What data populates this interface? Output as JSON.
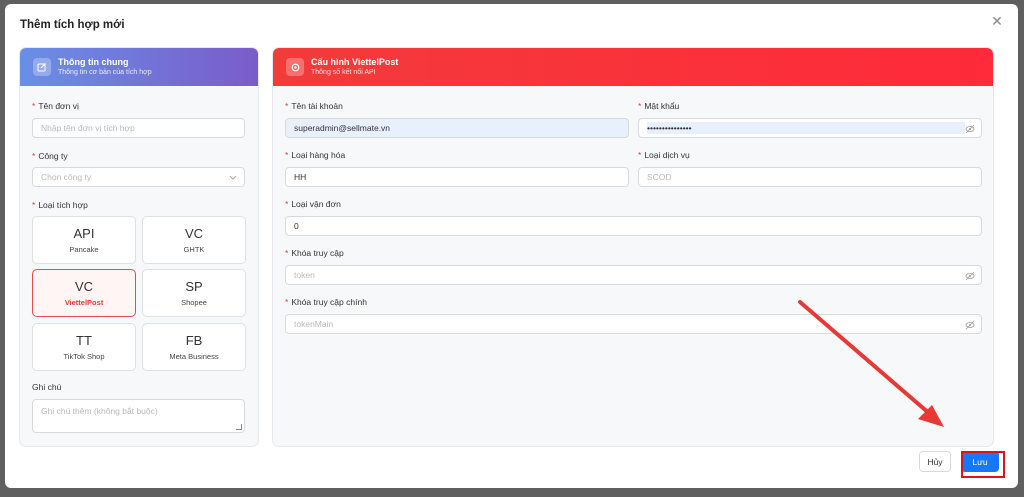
{
  "modal": {
    "title": "Thêm tích hợp mới"
  },
  "left": {
    "title": "Thông tin chung",
    "subtitle": "Thông tin cơ bản của tích hợp",
    "unit_label": "Tên đơn vị",
    "unit_placeholder": "Nhập tên đơn vị tích hợp",
    "company_label": "Công ty",
    "company_placeholder": "Chọn công ty",
    "type_label": "Loại tích hợp",
    "cards": [
      {
        "code": "API",
        "name": "Pancake"
      },
      {
        "code": "VC",
        "name": "GHTK"
      },
      {
        "code": "VC",
        "name": "ViettelPost"
      },
      {
        "code": "SP",
        "name": "Shopee"
      },
      {
        "code": "TT",
        "name": "TikTok Shop"
      },
      {
        "code": "FB",
        "name": "Meta Business"
      }
    ],
    "note_label": "Ghi chú",
    "note_placeholder": "Ghi chú thêm (không bắt buộc)"
  },
  "right": {
    "title": "Cấu hình ViettelPost",
    "subtitle": "Thông số kết nối API",
    "account_label": "Tên tài khoản",
    "account_value": "superadmin@sellmate.vn",
    "password_label": "Mật khẩu",
    "password_value": "•••••••••••••••",
    "goods_label": "Loại hàng hóa",
    "goods_value": "HH",
    "service_label": "Loại dịch vụ",
    "service_placeholder": "SCOD",
    "waybill_label": "Loại vận đơn",
    "waybill_value": "0",
    "token_label": "Khóa truy cập",
    "token_placeholder": "token",
    "token_main_label": "Khóa truy cập chính",
    "token_main_placeholder": "tokenMain"
  },
  "footer": {
    "cancel_label": "Hủy",
    "save_label": "Lưu"
  }
}
